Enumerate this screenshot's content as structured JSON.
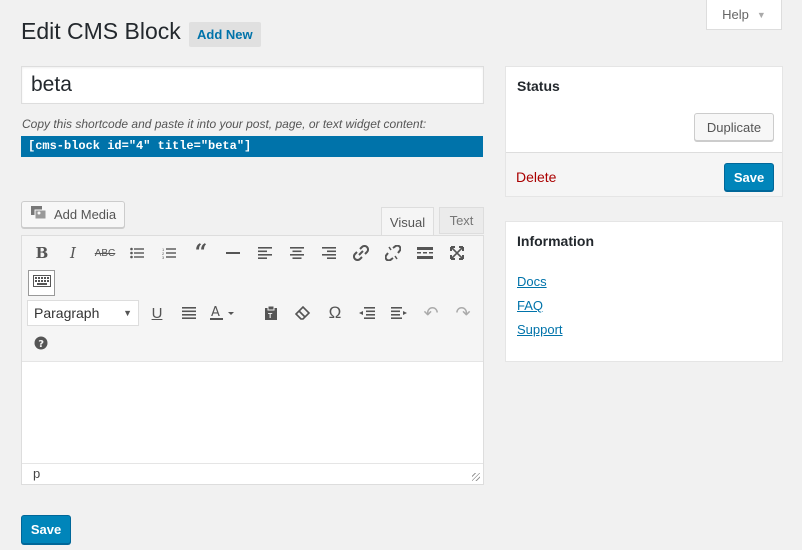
{
  "header": {
    "title": "Edit CMS Block",
    "add_new": "Add New",
    "help": "Help"
  },
  "post": {
    "title_value": "beta",
    "shortcode_hint": "Copy this shortcode and paste it into your post, page, or text widget content:",
    "shortcode": "[cms-block id=\"4\" title=\"beta\"]"
  },
  "editor": {
    "add_media": "Add Media",
    "tabs": {
      "visual": "Visual",
      "text": "Text"
    },
    "format_select": "Paragraph",
    "status_path": "p",
    "toolbar_row1": [
      "bold-icon",
      "italic-icon",
      "strikethrough-icon",
      "bullet-list-icon",
      "numbered-list-icon",
      "blockquote-icon",
      "horizontal-line-icon",
      "align-left-icon",
      "align-center-icon",
      "align-right-icon",
      "link-icon",
      "unlink-icon",
      "read-more-icon",
      "fullscreen-icon"
    ],
    "toolbar_row3": [
      "underline-icon",
      "justify-icon",
      "text-color-icon",
      "paste-text-icon",
      "clear-formatting-icon",
      "special-character-icon",
      "outdent-icon",
      "indent-icon",
      "undo-icon",
      "redo-icon"
    ]
  },
  "sidebar": {
    "status": {
      "title": "Status",
      "duplicate": "Duplicate",
      "delete": "Delete",
      "save": "Save"
    },
    "information": {
      "title": "Information",
      "links": [
        "Docs",
        "FAQ",
        "Support"
      ]
    }
  },
  "footer": {
    "save": "Save"
  },
  "colors": {
    "primary": "#0085ba",
    "link": "#0073aa",
    "delete": "#aa0000",
    "background": "#f1f1f1"
  }
}
